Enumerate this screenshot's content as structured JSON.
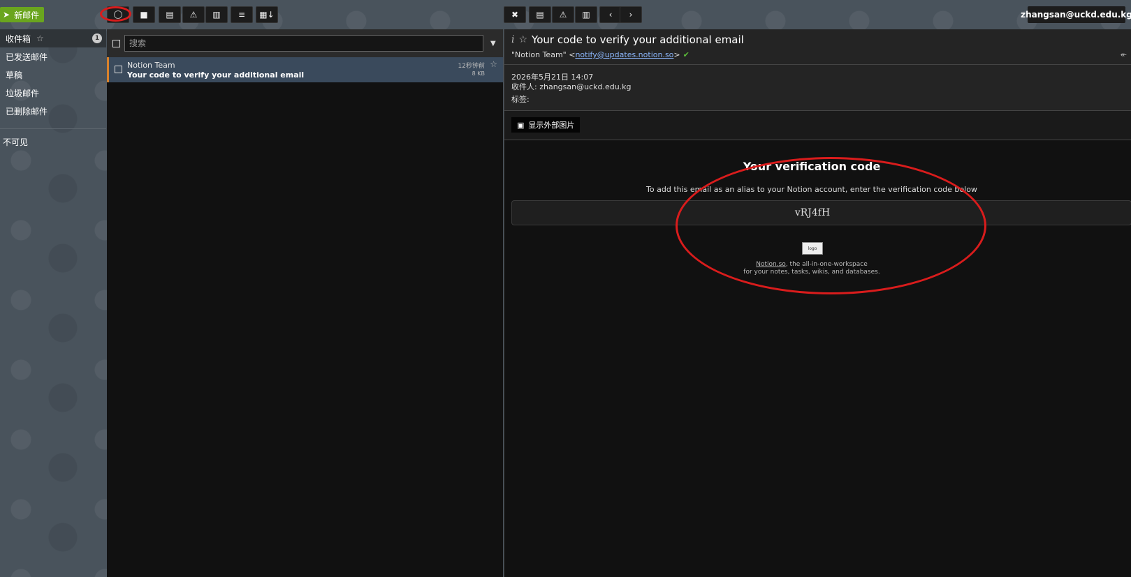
{
  "toolbar": {
    "compose_label": "新邮件",
    "compose_icon": "paper-plane-icon",
    "user_email": "zhangsan@uckd.edu.kg"
  },
  "sidebar": {
    "items": [
      {
        "label": "收件箱",
        "badge": "1"
      },
      {
        "label": "已发送邮件"
      },
      {
        "label": "草稿"
      },
      {
        "label": "垃圾邮件"
      },
      {
        "label": "已删除邮件"
      }
    ],
    "invisible_label": "不可见"
  },
  "list": {
    "search_placeholder": "搜索",
    "messages": [
      {
        "from": "Notion Team",
        "subject": "Your code to verify your additional email",
        "time": "12秒钟前",
        "size": "8 KB"
      }
    ]
  },
  "viewer": {
    "subject": "Your code to verify your additional email",
    "from_name": "\"Notion Team\"",
    "from_email": "notify@updates.notion.so",
    "date": "2026年5月21日 14:07",
    "to": "收件人: zhangsan@uckd.edu.kg",
    "tags": "标签:",
    "show_images_label": "显示外部图片",
    "body": {
      "title": "Your verification code",
      "text": "To add this email as an alias to your Notion account, enter the verification code below",
      "code": "vRJ4fH",
      "logo_alt": "logo",
      "footer_link": "Notion.so",
      "footer_rest": ", the all-in-one-workspace",
      "footer_line2": "for your notes, tasks, wikis, and databases."
    }
  },
  "colors": {
    "accent_green": "#6aa51e",
    "selected_row": "#3a4a5c",
    "annotation_red": "#d91c1c"
  }
}
